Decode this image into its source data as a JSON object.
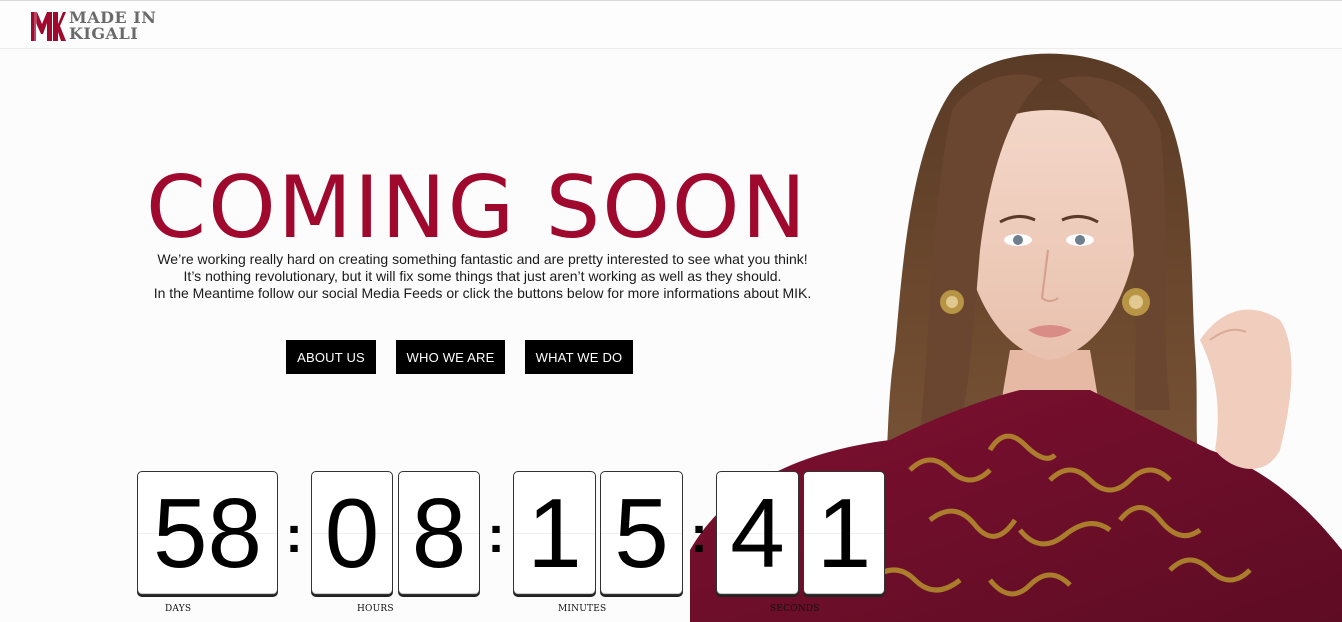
{
  "header": {
    "logo_line1": "MADE IN",
    "logo_line2": "KIGALI",
    "brand_color": "#a0092e"
  },
  "main": {
    "title": "COMING SOON",
    "paragraph": [
      "We’re working really hard on creating something fantastic and are pretty interested to see what you think!",
      "It’s nothing revolutionary, but it will fix some things that just aren’t working as well as they should.",
      "In the Meantime follow our social Media Feeds or click the buttons below for more informations about MIK."
    ],
    "buttons": {
      "about": "ABOUT US",
      "who": "WHO WE ARE",
      "what": "WHAT WE DO"
    }
  },
  "countdown": {
    "days": "58",
    "hours_digits": [
      "0",
      "8"
    ],
    "minutes_digits": [
      "1",
      "5"
    ],
    "seconds_digits": [
      "4",
      "1"
    ],
    "separator": ":",
    "labels": {
      "days": "DAYS",
      "hours": "HOURS",
      "minutes": "MINUTES",
      "seconds": "SECONDS"
    }
  }
}
